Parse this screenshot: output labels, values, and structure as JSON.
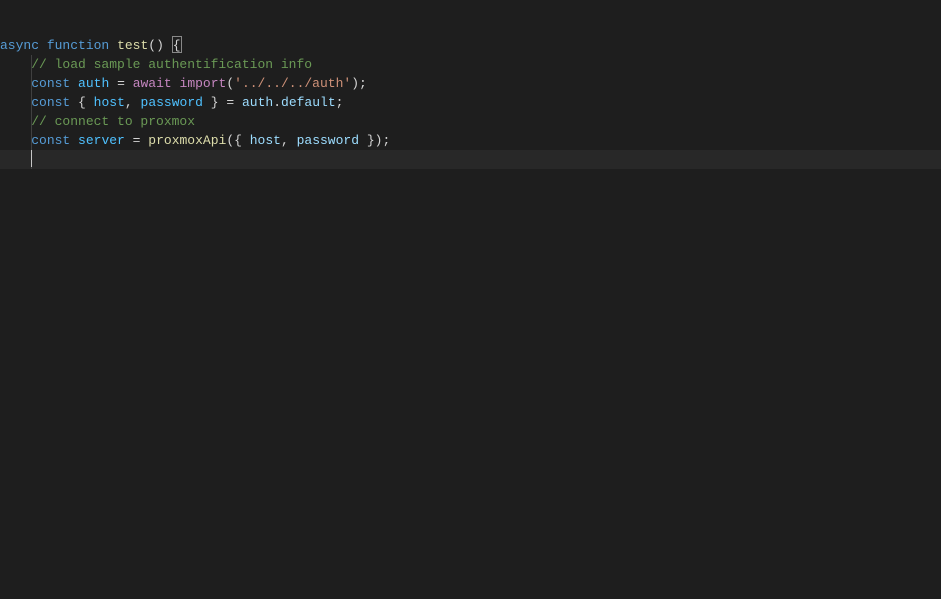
{
  "code": {
    "line1": {
      "async": "async",
      "function": "function",
      "name": "test",
      "parens": "()",
      "space": " ",
      "brace": "{"
    },
    "line2": "    // load sample authentification info",
    "line3": {
      "indent": "    ",
      "const": "const",
      "sp1": " ",
      "auth": "auth",
      "sp2": " ",
      "eq": "=",
      "sp3": " ",
      "await": "await",
      "sp4": " ",
      "import": "import",
      "paren_o": "(",
      "str": "'../../../auth'",
      "paren_c": ")",
      "semi": ";"
    },
    "line4": {
      "indent": "    ",
      "const": "const",
      "sp1": " ",
      "brace_o": "{",
      "sp2": " ",
      "host": "host",
      "comma": ",",
      "sp3": " ",
      "password": "password",
      "sp4": " ",
      "brace_c": "}",
      "sp5": " ",
      "eq": "=",
      "sp6": " ",
      "auth": "auth",
      "dot": ".",
      "default": "default",
      "semi": ";"
    },
    "line5": "    // connect to proxmox",
    "line6": {
      "indent": "    ",
      "const": "const",
      "sp1": " ",
      "server": "server",
      "sp2": " ",
      "eq": "=",
      "sp3": " ",
      "fn": "proxmoxApi",
      "paren_o": "(",
      "brace_o": "{",
      "sp4": " ",
      "host": "host",
      "comma": ",",
      "sp5": " ",
      "password": "password",
      "sp6": " ",
      "brace_c": "}",
      "paren_c": ")",
      "semi": ";"
    }
  }
}
